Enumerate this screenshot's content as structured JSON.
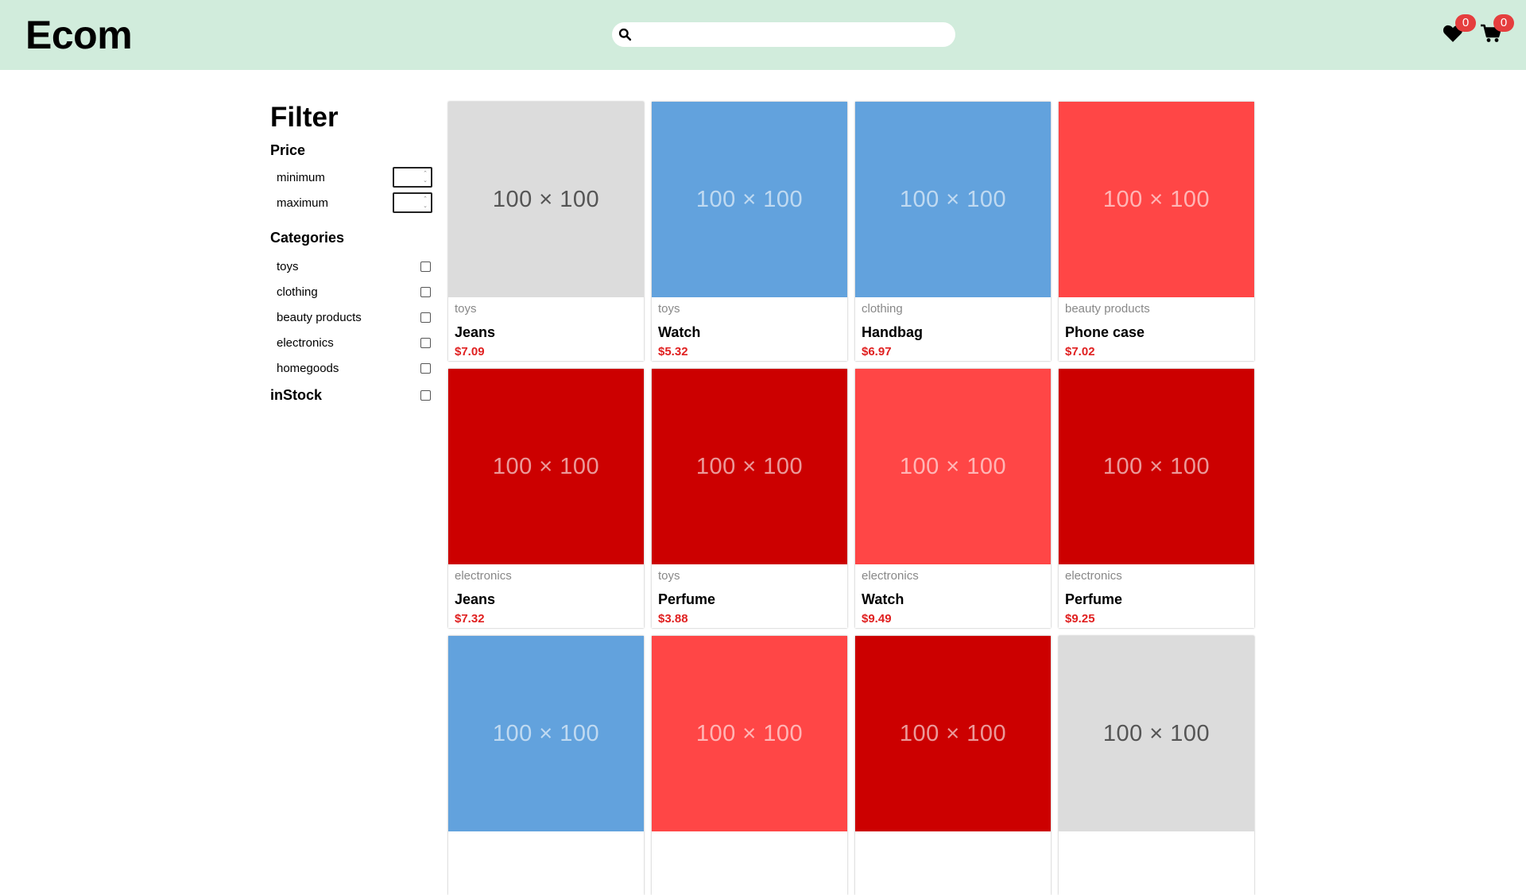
{
  "header": {
    "logo": "Ecom",
    "search_placeholder": "",
    "wishlist_count": "0",
    "cart_count": "0"
  },
  "filter": {
    "title": "Filter",
    "price_title": "Price",
    "min_label": "minimum",
    "max_label": "maximum",
    "min_value": "",
    "max_value": "",
    "categories_title": "Categories",
    "categories": [
      "toys",
      "clothing",
      "beauty products",
      "electronics",
      "homegoods"
    ],
    "instock_label": "inStock"
  },
  "colors": {
    "header_bg": "#d1ecdc",
    "grey": "#dcdcdc",
    "blue": "#62a2dd",
    "light_red": "#ff4646",
    "dark_red": "#cc0000",
    "price": "#e02020"
  },
  "products": [
    {
      "color": "grey",
      "thumb": "100 × 100",
      "category": "toys",
      "name": "Jeans",
      "price": "$7.09"
    },
    {
      "color": "blue",
      "thumb": "100 × 100",
      "category": "toys",
      "name": "Watch",
      "price": "$5.32"
    },
    {
      "color": "blue",
      "thumb": "100 × 100",
      "category": "clothing",
      "name": "Handbag",
      "price": "$6.97"
    },
    {
      "color": "light_red",
      "thumb": "100 × 100",
      "category": "beauty products",
      "name": "Phone case",
      "price": "$7.02"
    },
    {
      "color": "dark_red",
      "thumb": "100 × 100",
      "category": "electronics",
      "name": "Jeans",
      "price": "$7.32"
    },
    {
      "color": "dark_red",
      "thumb": "100 × 100",
      "category": "toys",
      "name": "Perfume",
      "price": "$3.88"
    },
    {
      "color": "light_red",
      "thumb": "100 × 100",
      "category": "electronics",
      "name": "Watch",
      "price": "$9.49"
    },
    {
      "color": "dark_red",
      "thumb": "100 × 100",
      "category": "electronics",
      "name": "Perfume",
      "price": "$9.25"
    },
    {
      "color": "blue",
      "thumb": "100 × 100"
    },
    {
      "color": "light_red",
      "thumb": "100 × 100"
    },
    {
      "color": "dark_red",
      "thumb": "100 × 100"
    },
    {
      "color": "grey",
      "thumb": "100 × 100"
    }
  ]
}
